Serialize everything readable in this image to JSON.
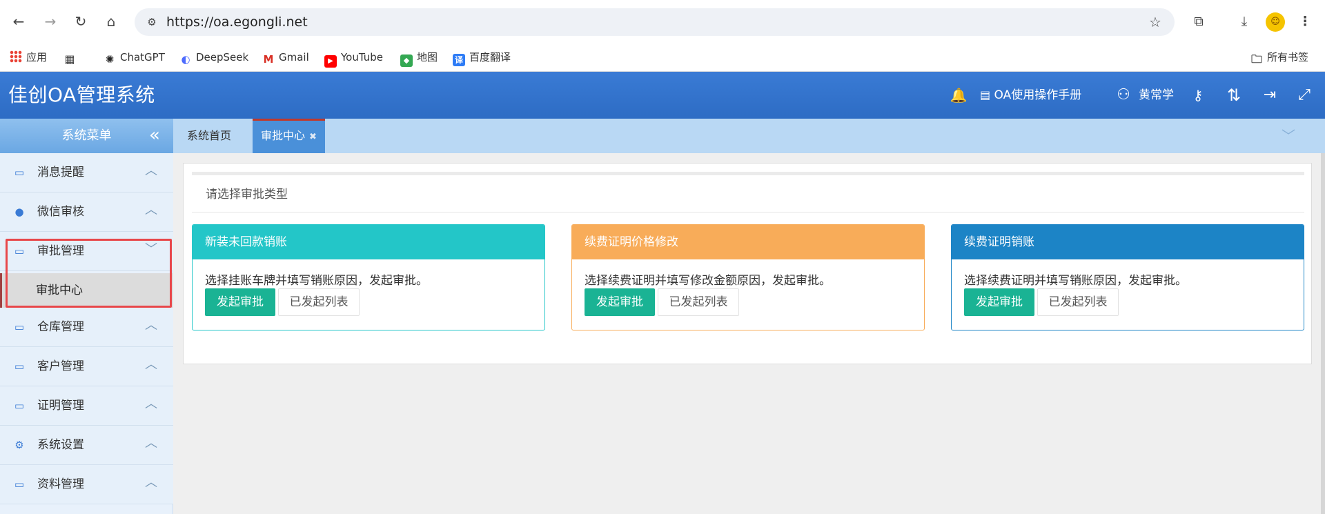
{
  "browser": {
    "url": "https://oa.egongli.net",
    "bookmarks": [
      {
        "label": "应用",
        "icon": "apps-grid-icon"
      },
      {
        "label": "",
        "icon": "tab-groups-icon"
      },
      {
        "label": "ChatGPT",
        "icon": "chatgpt-icon"
      },
      {
        "label": "DeepSeek",
        "icon": "deepseek-icon"
      },
      {
        "label": "Gmail",
        "icon": "gmail-icon"
      },
      {
        "label": "YouTube",
        "icon": "youtube-icon"
      },
      {
        "label": "地图",
        "icon": "maps-icon"
      },
      {
        "label": "百度翻译",
        "icon": "baidu-translate-icon"
      }
    ],
    "all_bookmarks": "所有书签"
  },
  "app": {
    "title": "佳创OA管理系统",
    "manual_link": "OA使用操作手册",
    "user_name": "黄常学"
  },
  "sidebar": {
    "title": "系统菜单",
    "items": [
      {
        "label": "消息提醒",
        "icon": "monitor-icon"
      },
      {
        "label": "微信审核",
        "icon": "chat-bubble-icon"
      },
      {
        "label": "审批管理",
        "icon": "monitor-icon",
        "expanded": true
      },
      {
        "label": "仓库管理",
        "icon": "monitor-icon"
      },
      {
        "label": "客户管理",
        "icon": "monitor-icon"
      },
      {
        "label": "证明管理",
        "icon": "monitor-icon"
      },
      {
        "label": "系统设置",
        "icon": "gear-icon"
      },
      {
        "label": "资料管理",
        "icon": "monitor-icon"
      }
    ],
    "subitem": "审批中心"
  },
  "tabs": [
    {
      "label": "系统首页",
      "active": false
    },
    {
      "label": "审批中心",
      "active": true,
      "close": "✖"
    }
  ],
  "main": {
    "panel_title": "请选择审批类型",
    "cards": [
      {
        "title": "新装未回款销账",
        "color": "#23c6c8",
        "description": "选择挂账车牌并填写销账原因，发起审批。",
        "primary_button": "发起审批",
        "secondary_button": "已发起列表"
      },
      {
        "title": "续费证明价格修改",
        "color": "#f8ac59",
        "description": "选择续费证明并填写修改金额原因，发起审批。",
        "primary_button": "发起审批",
        "secondary_button": "已发起列表"
      },
      {
        "title": "续费证明销账",
        "color": "#1c84c6",
        "description": "选择续费证明并填写销账原因，发起审批。",
        "primary_button": "发起审批",
        "secondary_button": "已发起列表"
      }
    ]
  },
  "colors": {
    "header": "#2d6cc4",
    "primary_button": "#1ab394",
    "highlight": "#e8474a"
  }
}
